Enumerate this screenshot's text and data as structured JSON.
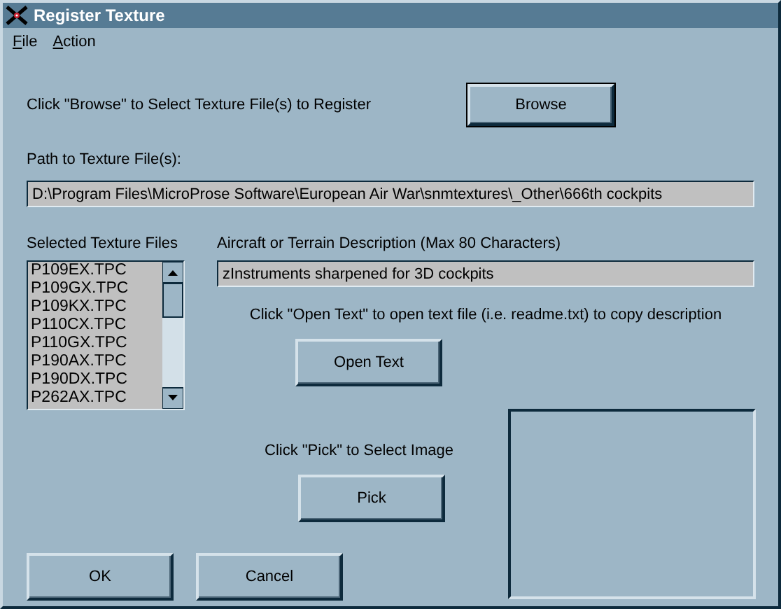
{
  "window": {
    "title": "Register Texture"
  },
  "menu": [
    "File",
    "Action"
  ],
  "browse": {
    "instruction": "Click \"Browse\" to Select Texture File(s) to Register",
    "button": "Browse"
  },
  "path": {
    "label": "Path to Texture File(s):",
    "value": "D:\\Program Files\\MicroProse Software\\European Air War\\snmtextures\\_Other\\666th cockpits"
  },
  "files": {
    "label": "Selected Texture Files",
    "items": [
      "P109EX.TPC",
      "P109GX.TPC",
      "P109KX.TPC",
      "P110CX.TPC",
      "P110GX.TPC",
      "P190AX.TPC",
      "P190DX.TPC",
      "P262AX.TPC"
    ]
  },
  "description": {
    "label": "Aircraft or Terrain Description  (Max 80 Characters)",
    "value": "zInstruments sharpened for 3D cockpits"
  },
  "open_text": {
    "instruction": "Click \"Open Text\" to open text file (i.e. readme.txt) to copy description",
    "button": "Open Text"
  },
  "pick": {
    "instruction": "Click \"Pick\" to Select Image",
    "button": "Pick"
  },
  "buttons": [
    "OK",
    "Cancel"
  ]
}
